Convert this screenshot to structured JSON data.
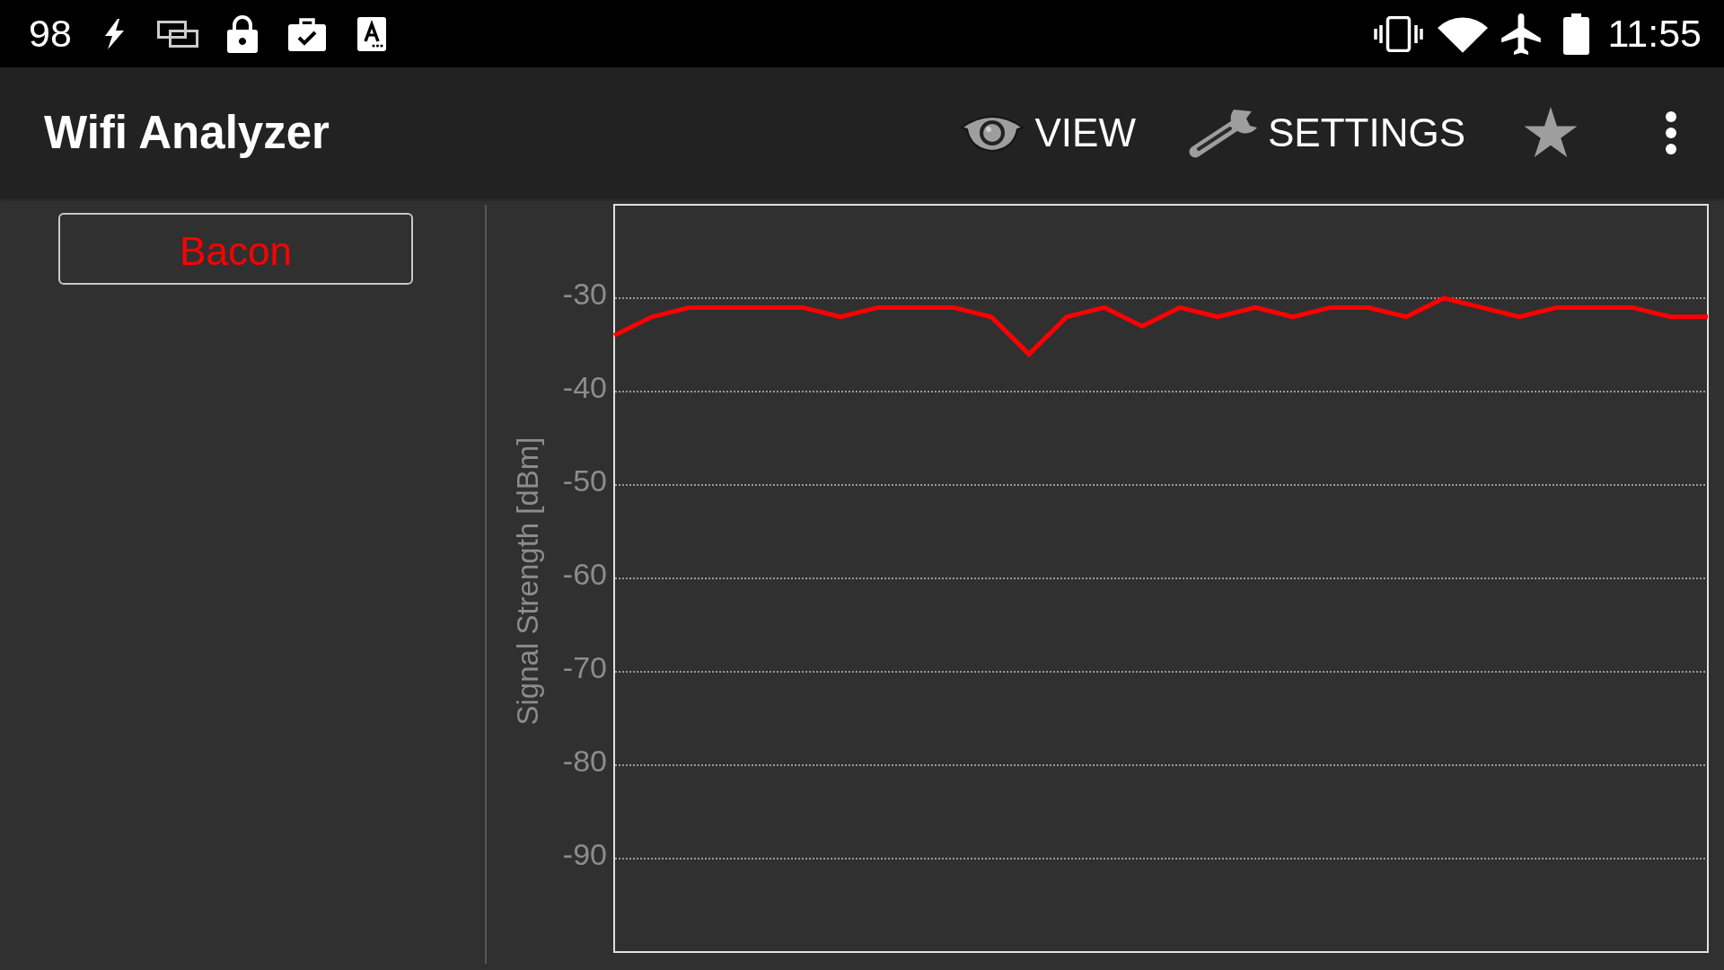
{
  "status_bar": {
    "left_number": "98",
    "time": "11:55"
  },
  "app_bar": {
    "title": "Wifi Analyzer",
    "actions": [
      {
        "label": "VIEW"
      },
      {
        "label": "SETTINGS"
      }
    ]
  },
  "content": {
    "chart_data": {
      "type": "line",
      "ylabel": "Signal Strength [dBm]",
      "ylim": [
        -100,
        -20
      ],
      "yticks": [
        -90,
        -80,
        -70,
        -60,
        -50,
        -40,
        -30
      ],
      "grid": true,
      "series": [
        {
          "name": "Bacon",
          "color": "#ff0000",
          "values": [
            -34,
            -32,
            -31,
            -31,
            -31,
            -31,
            -32,
            -31,
            -31,
            -31,
            -32,
            -36,
            -32,
            -31,
            -33,
            -31,
            -32,
            -31,
            -32,
            -31,
            -31,
            -32,
            -30,
            -31,
            -32,
            -31,
            -31,
            -31,
            -32,
            -32
          ]
        }
      ]
    }
  }
}
